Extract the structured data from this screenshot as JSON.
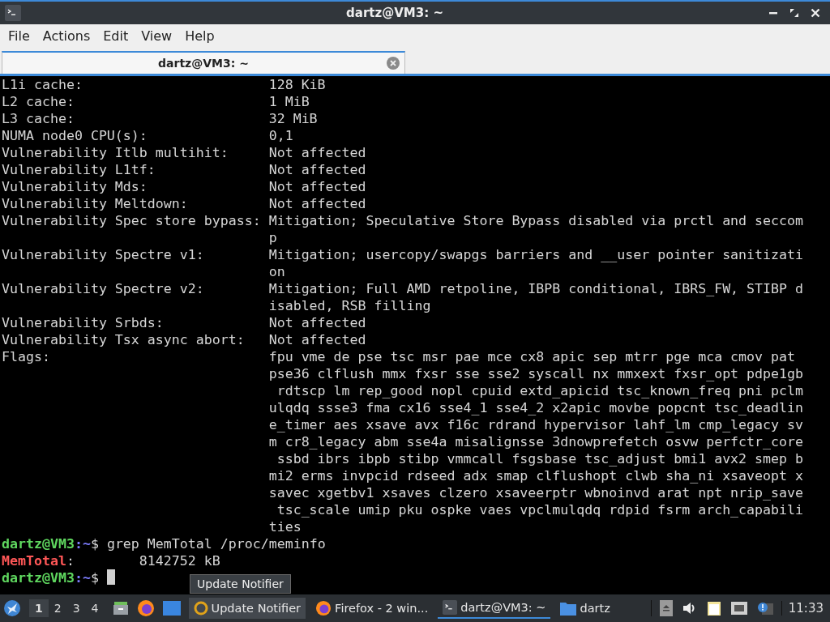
{
  "window": {
    "title": "dartz@VM3: ~"
  },
  "menu": [
    "File",
    "Actions",
    "Edit",
    "View",
    "Help"
  ],
  "tabs": [
    {
      "label": "dartz@VM3: ~",
      "selected": true
    }
  ],
  "terminal": {
    "lines": [
      {
        "kind": "field",
        "label": "L1i cache:",
        "value": "128 KiB"
      },
      {
        "kind": "field",
        "label": "L2 cache:",
        "value": "1 MiB"
      },
      {
        "kind": "field",
        "label": "L3 cache:",
        "value": "32 MiB"
      },
      {
        "kind": "field",
        "label": "NUMA node0 CPU(s):",
        "value": "0,1"
      },
      {
        "kind": "field",
        "label": "Vulnerability Itlb multihit:",
        "value": "Not affected"
      },
      {
        "kind": "field",
        "label": "Vulnerability L1tf:",
        "value": "Not affected"
      },
      {
        "kind": "field",
        "label": "Vulnerability Mds:",
        "value": "Not affected"
      },
      {
        "kind": "field",
        "label": "Vulnerability Meltdown:",
        "value": "Not affected"
      },
      {
        "kind": "field",
        "label": "Vulnerability Spec store bypass:",
        "value": "Mitigation; Speculative Store Bypass disabled via prctl and seccom"
      },
      {
        "kind": "cont",
        "value": "p"
      },
      {
        "kind": "field",
        "label": "Vulnerability Spectre v1:",
        "value": "Mitigation; usercopy/swapgs barriers and __user pointer sanitizati"
      },
      {
        "kind": "cont",
        "value": "on"
      },
      {
        "kind": "field",
        "label": "Vulnerability Spectre v2:",
        "value": "Mitigation; Full AMD retpoline, IBPB conditional, IBRS_FW, STIBP d"
      },
      {
        "kind": "cont",
        "value": "isabled, RSB filling"
      },
      {
        "kind": "field",
        "label": "Vulnerability Srbds:",
        "value": "Not affected"
      },
      {
        "kind": "field",
        "label": "Vulnerability Tsx async abort:",
        "value": "Not affected"
      },
      {
        "kind": "field",
        "label": "Flags:",
        "value": "fpu vme de pse tsc msr pae mce cx8 apic sep mtrr pge mca cmov pat"
      },
      {
        "kind": "cont",
        "value": "pse36 clflush mmx fxsr sse sse2 syscall nx mmxext fxsr_opt pdpe1gb"
      },
      {
        "kind": "cont",
        "value": " rdtscp lm rep_good nopl cpuid extd_apicid tsc_known_freq pni pclm"
      },
      {
        "kind": "cont",
        "value": "ulqdq ssse3 fma cx16 sse4_1 sse4_2 x2apic movbe popcnt tsc_deadlin"
      },
      {
        "kind": "cont",
        "value": "e_timer aes xsave avx f16c rdrand hypervisor lahf_lm cmp_legacy sv"
      },
      {
        "kind": "cont",
        "value": "m cr8_legacy abm sse4a misalignsse 3dnowprefetch osvw perfctr_core"
      },
      {
        "kind": "cont",
        "value": " ssbd ibrs ibpb stibp vmmcall fsgsbase tsc_adjust bmi1 avx2 smep b"
      },
      {
        "kind": "cont",
        "value": "mi2 erms invpcid rdseed adx smap clflushopt clwb sha_ni xsaveopt x"
      },
      {
        "kind": "cont",
        "value": "savec xgetbv1 xsaves clzero xsaveerptr wbnoinvd arat npt nrip_save"
      },
      {
        "kind": "cont",
        "value": " tsc_scale umip pku ospke vaes vpclmulqdq rdpid fsrm arch_capabili"
      },
      {
        "kind": "cont",
        "value": "ties"
      },
      {
        "kind": "prompt",
        "user": "dartz@VM3",
        "sep": ":",
        "path": "~",
        "symbol": "$",
        "command": "grep MemTotal /proc/meminfo"
      },
      {
        "kind": "match",
        "key": "MemTotal",
        "rest": ":        8142752 kB"
      },
      {
        "kind": "prompt",
        "user": "dartz@VM3",
        "sep": ":",
        "path": "~",
        "symbol": "$",
        "cursor": true
      }
    ]
  },
  "taskbar": {
    "workspaces": [
      {
        "label": "1",
        "selected": true
      },
      {
        "label": "2",
        "selected": false
      },
      {
        "label": "3",
        "selected": false
      },
      {
        "label": "4",
        "selected": false
      }
    ],
    "launchers": [
      {
        "kind": "files"
      },
      {
        "kind": "firefox"
      },
      {
        "kind": "desktop"
      }
    ],
    "tasks": [
      {
        "kind": "update",
        "label": "Update Notifier",
        "selected": false,
        "hovered": true
      },
      {
        "kind": "firefox",
        "label": "Firefox - 2 win...",
        "selected": false,
        "hovered": false
      },
      {
        "kind": "terminal",
        "label": "dartz@VM3: ~",
        "selected": true,
        "hovered": false
      },
      {
        "kind": "folder",
        "label": "dartz",
        "selected": false,
        "hovered": false
      }
    ],
    "tray": [
      {
        "kind": "eject"
      },
      {
        "kind": "volume"
      },
      {
        "kind": "clipboard"
      },
      {
        "kind": "network"
      },
      {
        "kind": "notify"
      }
    ],
    "clock": "11:33"
  },
  "tooltip": "Update Notifier"
}
